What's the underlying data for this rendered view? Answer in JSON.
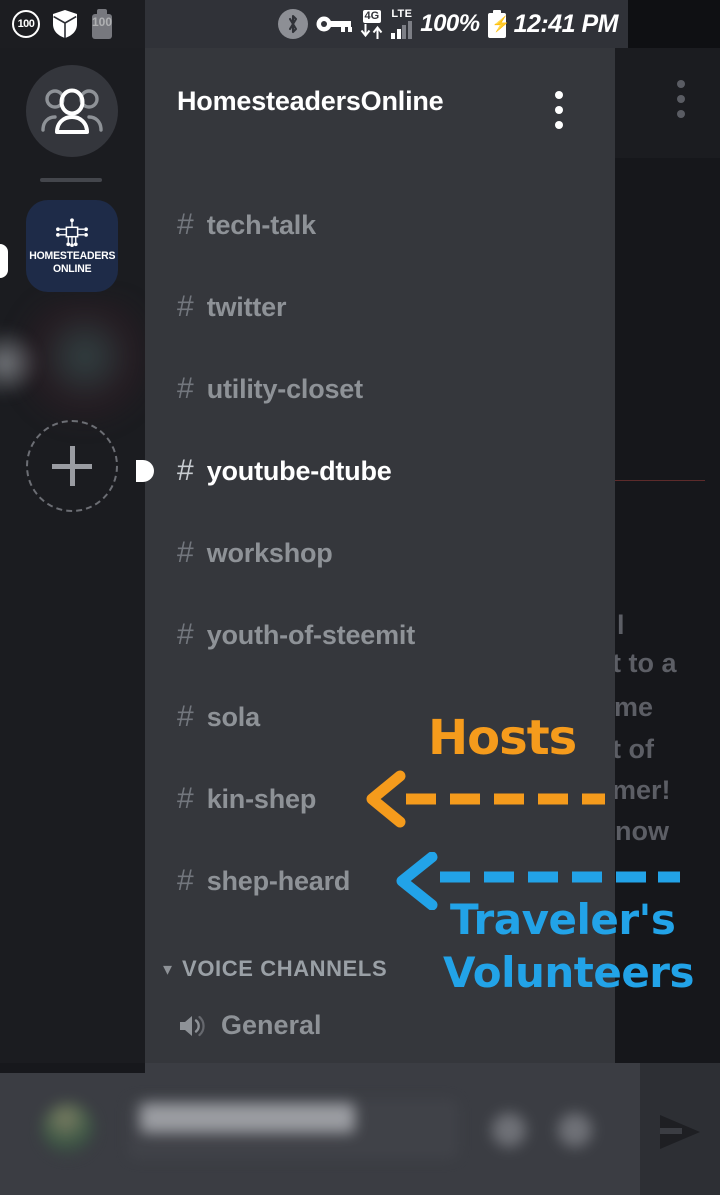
{
  "statusbar": {
    "left_icons": [
      {
        "name": "notification-count-badge",
        "label": "100"
      },
      {
        "name": "shield-icon",
        "label": ""
      },
      {
        "name": "battery-notification-icon",
        "label": "100"
      }
    ],
    "bluetooth_icon": "bluetooth-icon",
    "vpn_key_icon": "vpn-key-icon",
    "network_tag": "4G",
    "network_label": "LTE",
    "battery_percent": "100%",
    "battery_icon": "charging-battery-icon",
    "clock": "12:41 PM"
  },
  "rail": {
    "home_icon": "friends-people-icon",
    "server_icon_line1": "HOMESTEADERS",
    "server_icon_line2": "ONLINE",
    "add_server_icon": "plus-icon"
  },
  "drawer": {
    "server_name": "HomesteadersOnline",
    "menu_icon": "kebab-menu-icon",
    "text_channels": [
      {
        "name": "tech-talk",
        "active": false,
        "unread": false
      },
      {
        "name": "twitter",
        "active": false,
        "unread": false
      },
      {
        "name": "utility-closet",
        "active": false,
        "unread": false
      },
      {
        "name": "youtube-dtube",
        "active": true,
        "unread": true
      },
      {
        "name": "workshop",
        "active": false,
        "unread": false
      },
      {
        "name": "youth-of-steemit",
        "active": false,
        "unread": false
      },
      {
        "name": "sola",
        "active": false,
        "unread": false
      },
      {
        "name": "kin-shep",
        "active": false,
        "unread": false
      },
      {
        "name": "shep-heard",
        "active": false,
        "unread": false
      }
    ],
    "voice_category": "VOICE CHANNELS",
    "voice_channels": [
      {
        "name": "General",
        "icon": "speaker-icon"
      }
    ]
  },
  "annotations": [
    {
      "id": "hosts",
      "text": "Hosts",
      "color": "#F59B1C",
      "points_to": "kin-shep",
      "arrow": "dashed-left-arrow"
    },
    {
      "id": "travelers-volunteers",
      "text_line1": "Traveler's",
      "text_line2": "Volunteers",
      "color": "#22A3E8",
      "points_to": "shep-heard",
      "arrow": "dashed-left-arrow"
    }
  ],
  "background_chat": {
    "menu_icon": "kebab-menu-icon",
    "new-messages-divider-color": "#5d2b2b",
    "visible_text_fragments": [
      "l",
      "t to a",
      "me",
      "t of",
      "mer!",
      "now"
    ]
  },
  "message_bar": {
    "avatar": "user-avatar",
    "input_placeholder": "",
    "icon1": "attachment-icon",
    "icon2": "emoji-icon",
    "send_icon": "send-arrow-icon"
  },
  "colors": {
    "drawer_bg": "#35373c",
    "rail_bg": "#1b1c20",
    "chat_bg": "#16171b",
    "channel_text": "#8e9297",
    "active_channel_text": "#ffffff",
    "server_icon_bg": "#1e2b48",
    "annotation_orange": "#F59B1C",
    "annotation_blue": "#22A3E8"
  }
}
